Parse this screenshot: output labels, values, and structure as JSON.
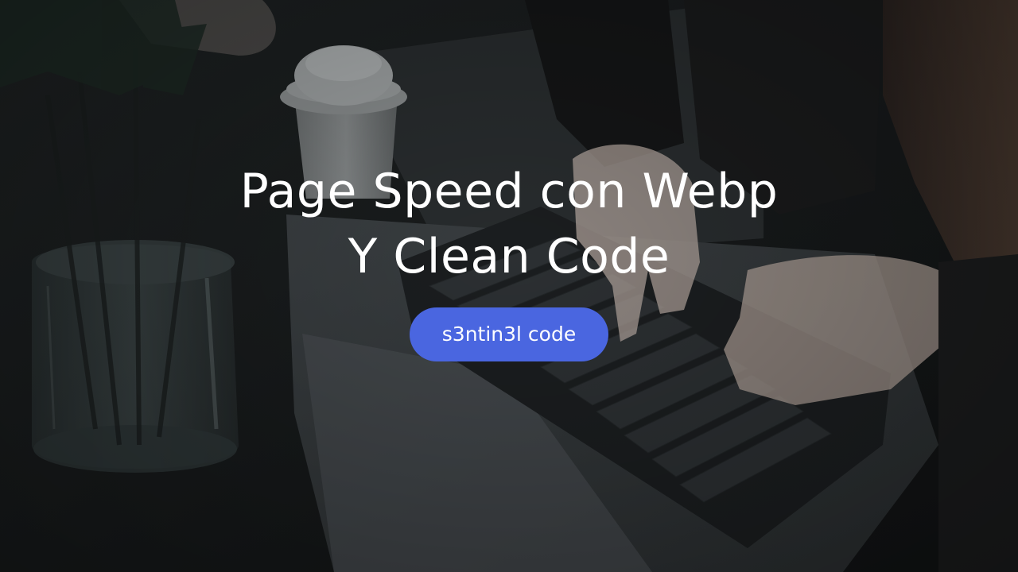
{
  "banner": {
    "title_line1": "Page Speed con Webp",
    "title_line2": "Y Clean Code",
    "badge_label": "s3ntin3l code"
  },
  "colors": {
    "badge": "#4a66e0",
    "title": "#ffffff",
    "background": "#15181a"
  }
}
